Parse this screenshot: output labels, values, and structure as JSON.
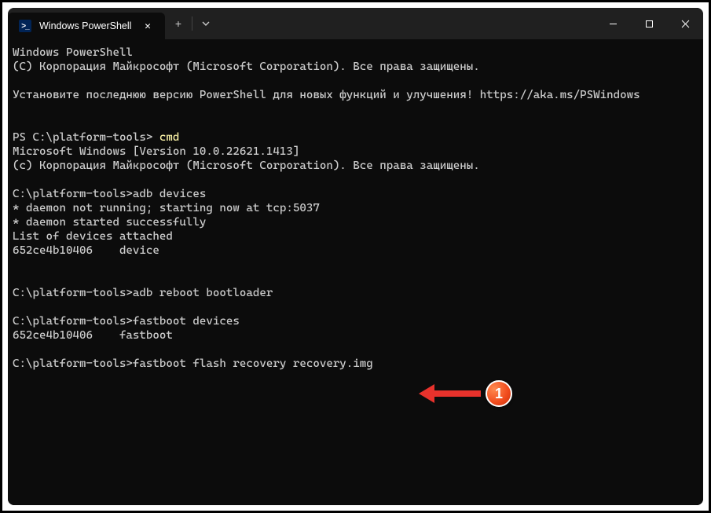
{
  "tab": {
    "title": "Windows PowerShell"
  },
  "term": {
    "l1": "Windows PowerShell",
    "l2": "(C) Корпорация Майкрософт (Microsoft Corporation). Все права защищены.",
    "l3": "Установите последнюю версию PowerShell для новых функций и улучшения! https://aka.ms/PSWindows",
    "l4a": "PS C:\\platform-tools> ",
    "l4b": "cmd",
    "l5": "Microsoft Windows [Version 10.0.22621.1413]",
    "l6": "(c) Корпорация Майкрософт (Microsoft Corporation). Все права защищены.",
    "l7": "C:\\platform-tools>adb devices",
    "l8": "* daemon not running; starting now at tcp:5037",
    "l9": "* daemon started successfully",
    "l10": "List of devices attached",
    "l11": "652ce4b10406    device",
    "l12": "C:\\platform-tools>adb reboot bootloader",
    "l13": "C:\\platform-tools>fastboot devices",
    "l14": "652ce4b10406    fastboot",
    "l15": "C:\\platform-tools>fastboot flash recovery recovery.img"
  },
  "badge": {
    "number": "1"
  }
}
